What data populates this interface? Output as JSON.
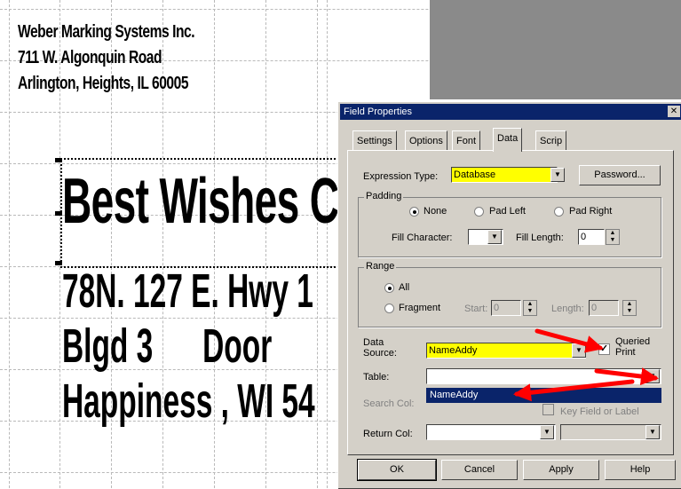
{
  "label": {
    "address_lines": [
      "Weber Marking Systems Inc.",
      "711 W. Algonquin Road",
      "Arlington, Heights, IL 60005"
    ],
    "line1": "Best Wishes Card",
    "line2": "78N. 127 E. Hwy 1",
    "line3": "Blgd 3      Door",
    "line4": "Happiness , WI 54"
  },
  "dialog": {
    "title": "Field Properties",
    "tabs": [
      "Settings",
      "Options",
      "Font",
      "Data",
      "Scrip"
    ],
    "active_tab": "Data",
    "expression_type_label": "Expression Type:",
    "expression_type_value": "Database",
    "password_button": "Password...",
    "padding_group": "Padding",
    "pad_none": "None",
    "pad_left": "Pad Left",
    "pad_right": "Pad Right",
    "fill_character_label": "Fill Character:",
    "fill_length_label": "Fill Length:",
    "fill_length_value": "0",
    "range_group": "Range",
    "range_all": "All",
    "range_fragment": "Fragment",
    "start_label": "Start:",
    "start_value": "0",
    "length_label": "Length:",
    "length_value": "0",
    "data_source_label": "Data Source:",
    "data_source_value": "NameAddy",
    "queried_print_label": "Queried Print",
    "table_label": "Table:",
    "table_value": "",
    "table_dropdown_option": "NameAddy",
    "search_col_label": "Search Col:",
    "key_field_label": "Key Field or Label",
    "return_col_label": "Return Col:",
    "ok_button": "OK",
    "cancel_button": "Cancel",
    "apply_button": "Apply",
    "help_button": "Help"
  },
  "colors": {
    "highlight_yellow": "#ffff00",
    "arrow_red": "#ff0000",
    "titlebar_blue": "#0a246a",
    "dialog_face": "#d4d0c8"
  }
}
